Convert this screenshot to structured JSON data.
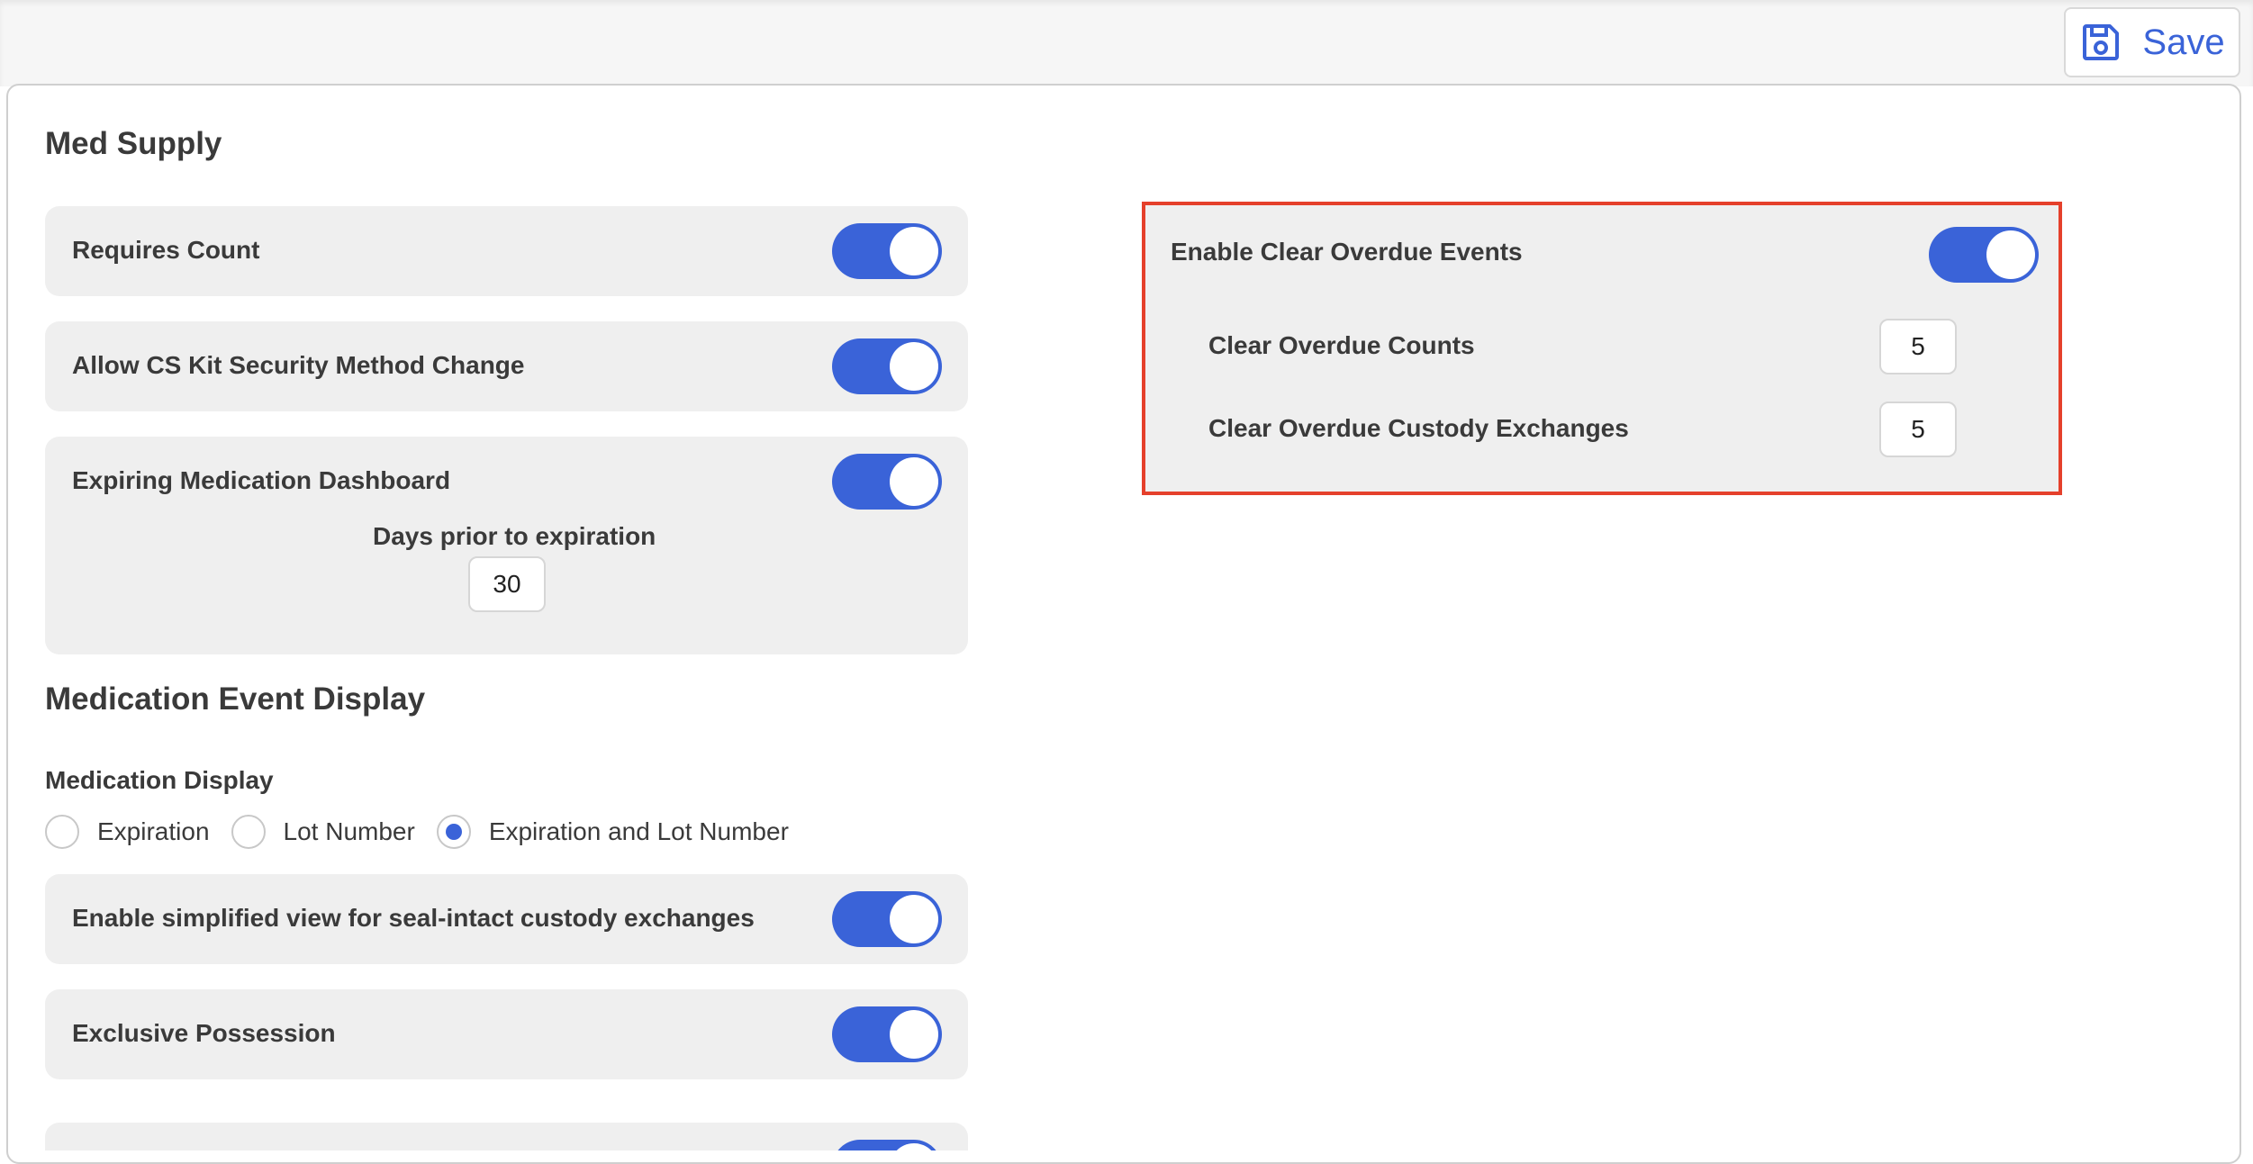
{
  "toolbar": {
    "save_label": "Save",
    "save_icon": "floppy-disk-icon",
    "accent_color": "#3a63d8"
  },
  "med_supply": {
    "heading": "Med Supply",
    "requires_count": {
      "label": "Requires Count",
      "enabled": true
    },
    "allow_cs_kit": {
      "label": "Allow CS Kit Security Method Change",
      "enabled": true
    },
    "expiring_dashboard": {
      "label": "Expiring Medication Dashboard",
      "enabled": true,
      "days_label": "Days prior to expiration",
      "days_value": "30"
    }
  },
  "clear_overdue": {
    "label": "Enable Clear Overdue Events",
    "enabled": true,
    "counts_label": "Clear Overdue Counts",
    "counts_value": "5",
    "custody_label": "Clear Overdue Custody Exchanges",
    "custody_value": "5",
    "highlight_color": "#e5402b"
  },
  "medication_event_display": {
    "heading": "Medication Event Display",
    "medication_display_label": "Medication Display",
    "options": [
      {
        "label": "Expiration",
        "checked": false
      },
      {
        "label": "Lot Number",
        "checked": false
      },
      {
        "label": "Expiration and Lot Number",
        "checked": true
      }
    ],
    "simplified_view": {
      "label": "Enable simplified view for seal-intact custody exchanges",
      "enabled": true
    },
    "exclusive_possession": {
      "label": "Exclusive Possession",
      "enabled": true
    }
  }
}
